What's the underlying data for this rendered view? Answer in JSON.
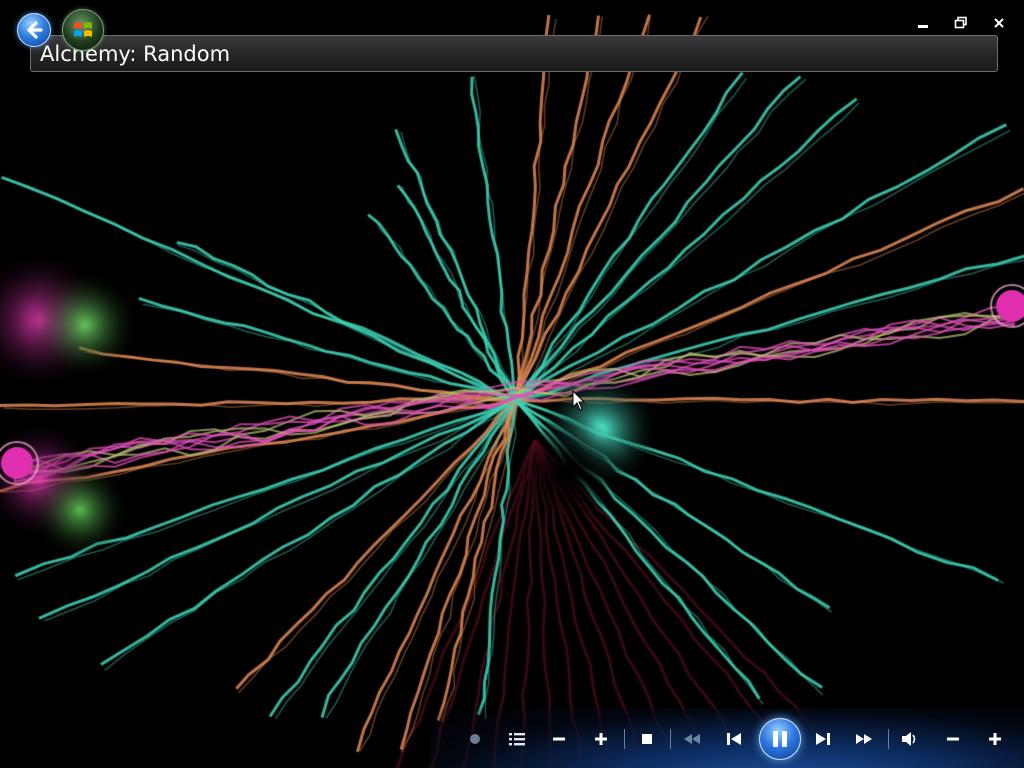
{
  "window": {
    "title": "Alchemy: Random"
  },
  "colors": {
    "teal": "#3fd6b8",
    "orange": "#e28a55",
    "pink": "#e050b8",
    "olive": "#b8c070",
    "magenta": "#e030b0",
    "green": "#60e070"
  },
  "icons": {
    "back": "back-arrow-icon",
    "start_orb": "windows-orb-icon",
    "minimize": "minimize-icon",
    "restore": "restore-icon",
    "close": "close-icon",
    "shuffle": "shuffle-dot-icon",
    "playlist": "playlist-icon",
    "zoom_out": "minus-icon",
    "zoom_in": "plus-icon",
    "stop": "stop-icon",
    "rewind": "rewind-icon",
    "previous": "previous-track-icon",
    "pause": "pause-icon",
    "next": "next-track-icon",
    "fast_forward": "fast-forward-icon",
    "volume": "volume-icon",
    "volume_down": "minus-icon",
    "volume_up": "plus-icon"
  }
}
